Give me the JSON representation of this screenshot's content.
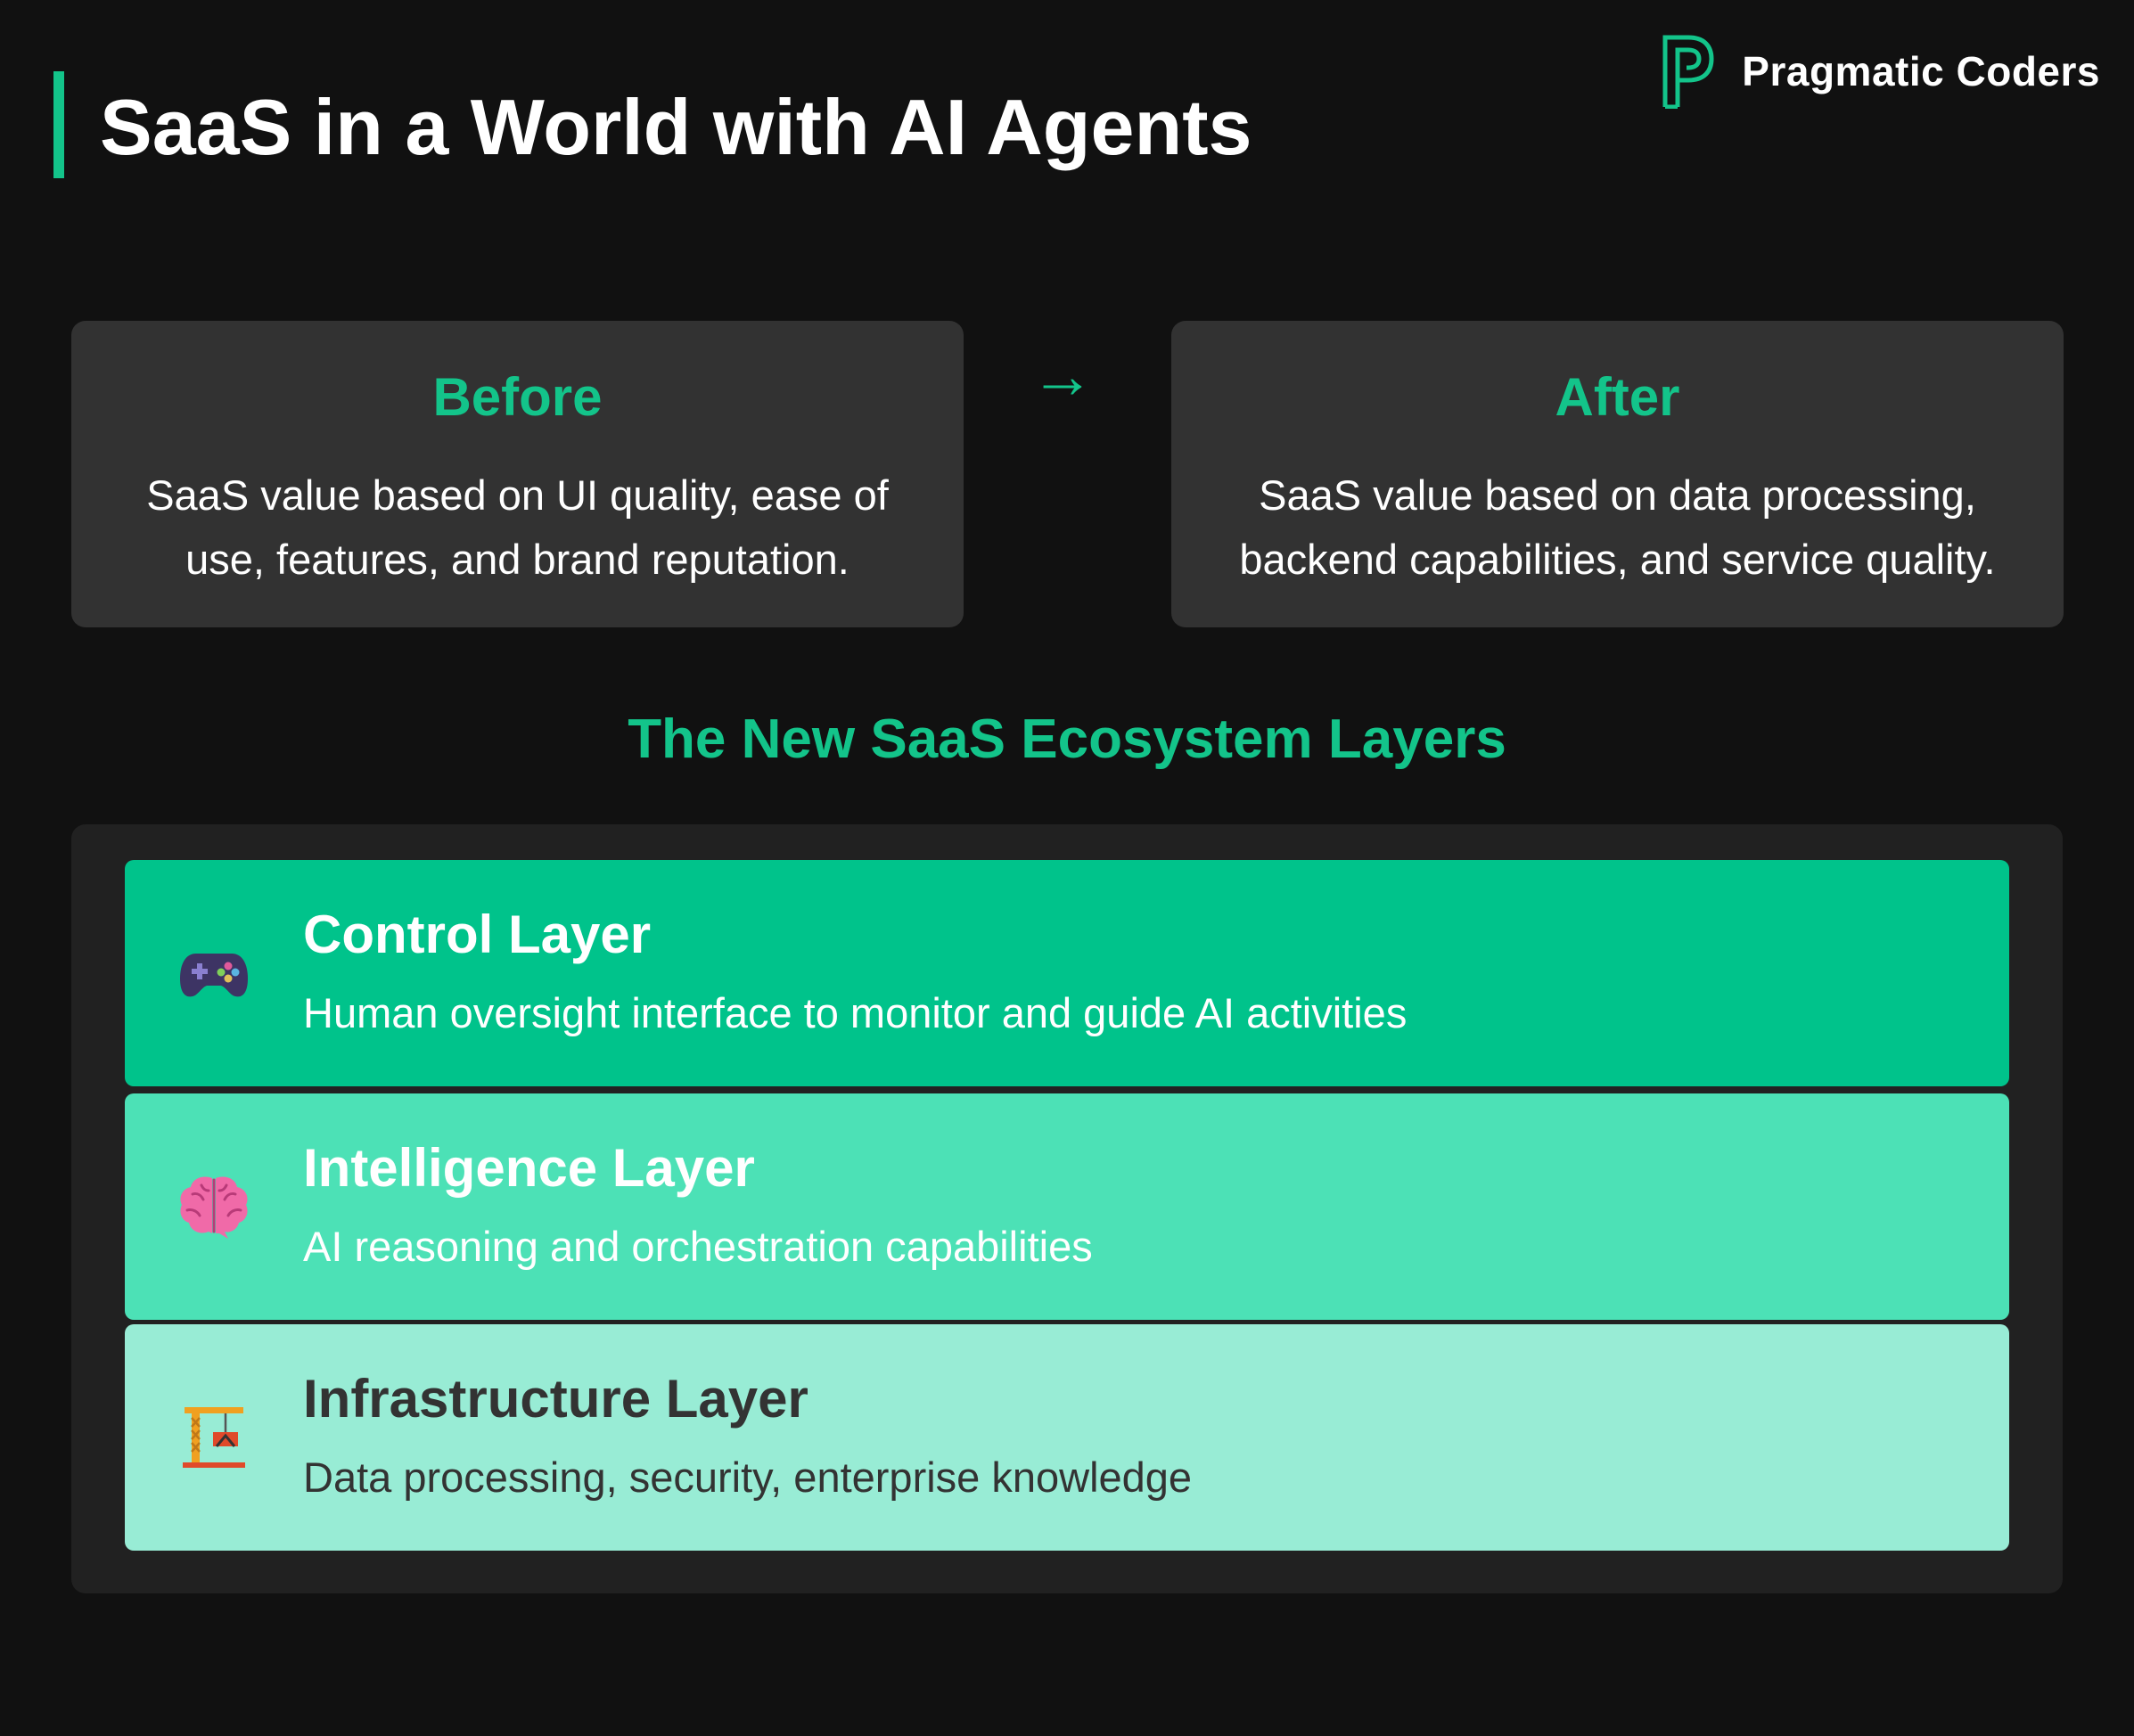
{
  "header": {
    "title": "SaaS in a World with AI Agents",
    "brand_name": "Pragmatic Coders"
  },
  "comparison": {
    "before": {
      "heading": "Before",
      "text": "SaaS value based on UI quality, ease of use, features, and brand reputation."
    },
    "arrow": "→",
    "after": {
      "heading": "After",
      "text": "SaaS value based on data processing, backend capabilities, and service quality."
    }
  },
  "ecosystem": {
    "title": "The New SaaS Ecosystem Layers",
    "layers": [
      {
        "icon": "game-controller-icon",
        "title": "Control Layer",
        "description": "Human oversight interface to monitor and guide AI activities",
        "color": "#00c38b"
      },
      {
        "icon": "brain-icon",
        "title": "Intelligence Layer",
        "description": "AI reasoning and orchestration capabilities",
        "color": "#4ce1b6"
      },
      {
        "icon": "construction-crane-icon",
        "title": "Infrastructure Layer",
        "description": "Data processing, security, enterprise knowledge",
        "color": "#98ecd5"
      }
    ]
  },
  "colors": {
    "background": "#111111",
    "accent": "#13c48a",
    "card": "#323232",
    "panel": "#212121"
  }
}
